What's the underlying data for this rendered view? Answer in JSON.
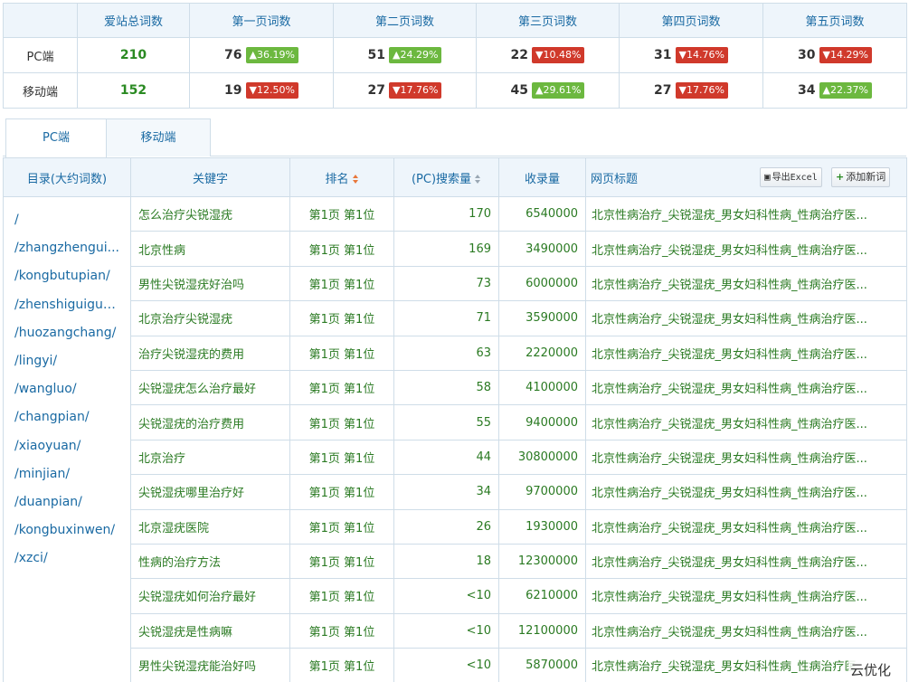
{
  "summary": {
    "headers": [
      "",
      "爱站总词数",
      "第一页词数",
      "第二页词数",
      "第三页词数",
      "第四页词数",
      "第五页词数"
    ],
    "rows": [
      {
        "label": "PC端",
        "total": "210",
        "pages": [
          {
            "num": "76",
            "change": "▲36.19%",
            "dir": "up"
          },
          {
            "num": "51",
            "change": "▲24.29%",
            "dir": "up"
          },
          {
            "num": "22",
            "change": "▼10.48%",
            "dir": "down"
          },
          {
            "num": "31",
            "change": "▼14.76%",
            "dir": "down"
          },
          {
            "num": "30",
            "change": "▼14.29%",
            "dir": "down"
          }
        ]
      },
      {
        "label": "移动端",
        "total": "152",
        "pages": [
          {
            "num": "19",
            "change": "▼12.50%",
            "dir": "down"
          },
          {
            "num": "27",
            "change": "▼17.76%",
            "dir": "down"
          },
          {
            "num": "45",
            "change": "▲29.61%",
            "dir": "up"
          },
          {
            "num": "27",
            "change": "▼17.76%",
            "dir": "down"
          },
          {
            "num": "34",
            "change": "▲22.37%",
            "dir": "up"
          }
        ]
      }
    ]
  },
  "tabs": {
    "pc": "PC端",
    "mobile": "移动端"
  },
  "table": {
    "headers": {
      "dir": "目录(大约词数)",
      "keyword": "关键字",
      "rank": "排名",
      "search": "(PC)搜索量",
      "indexed": "收录量",
      "title": "网页标题"
    },
    "export_label": "导出Excel",
    "add_label": "添加新词",
    "dirs": [
      "/",
      "/zhangzhengui...",
      "/kongbutupian/",
      "/zhenshiguigus...",
      "/huozangchang/",
      "/lingyi/",
      "/wangluo/",
      "/changpian/",
      "/xiaoyuan/",
      "/minjian/",
      "/duanpian/",
      "/kongbuxinwen/",
      "/xzci/"
    ],
    "rows": [
      {
        "kw": "怎么治疗尖锐湿疣",
        "rank": "第1页 第1位",
        "search": "170",
        "indexed": "6540000",
        "title": "北京性病治疗_尖锐湿疣_男女妇科性病_性病治疗医..."
      },
      {
        "kw": "北京性病",
        "rank": "第1页 第1位",
        "search": "169",
        "indexed": "3490000",
        "title": "北京性病治疗_尖锐湿疣_男女妇科性病_性病治疗医..."
      },
      {
        "kw": "男性尖锐湿疣好治吗",
        "rank": "第1页 第1位",
        "search": "73",
        "indexed": "6000000",
        "title": "北京性病治疗_尖锐湿疣_男女妇科性病_性病治疗医..."
      },
      {
        "kw": "北京治疗尖锐湿疣",
        "rank": "第1页 第1位",
        "search": "71",
        "indexed": "3590000",
        "title": "北京性病治疗_尖锐湿疣_男女妇科性病_性病治疗医..."
      },
      {
        "kw": "治疗尖锐湿疣的费用",
        "rank": "第1页 第1位",
        "search": "63",
        "indexed": "2220000",
        "title": "北京性病治疗_尖锐湿疣_男女妇科性病_性病治疗医..."
      },
      {
        "kw": "尖锐湿疣怎么治疗最好",
        "rank": "第1页 第1位",
        "search": "58",
        "indexed": "4100000",
        "title": "北京性病治疗_尖锐湿疣_男女妇科性病_性病治疗医..."
      },
      {
        "kw": "尖锐湿疣的治疗费用",
        "rank": "第1页 第1位",
        "search": "55",
        "indexed": "9400000",
        "title": "北京性病治疗_尖锐湿疣_男女妇科性病_性病治疗医..."
      },
      {
        "kw": "北京治疗",
        "rank": "第1页 第1位",
        "search": "44",
        "indexed": "30800000",
        "title": "北京性病治疗_尖锐湿疣_男女妇科性病_性病治疗医..."
      },
      {
        "kw": "尖锐湿疣哪里治疗好",
        "rank": "第1页 第1位",
        "search": "34",
        "indexed": "9700000",
        "title": "北京性病治疗_尖锐湿疣_男女妇科性病_性病治疗医..."
      },
      {
        "kw": "北京湿疣医院",
        "rank": "第1页 第1位",
        "search": "26",
        "indexed": "1930000",
        "title": "北京性病治疗_尖锐湿疣_男女妇科性病_性病治疗医..."
      },
      {
        "kw": "性病的治疗方法",
        "rank": "第1页 第1位",
        "search": "18",
        "indexed": "12300000",
        "title": "北京性病治疗_尖锐湿疣_男女妇科性病_性病治疗医..."
      },
      {
        "kw": "尖锐湿疣如何治疗最好",
        "rank": "第1页 第1位",
        "search": "<10",
        "indexed": "6210000",
        "title": "北京性病治疗_尖锐湿疣_男女妇科性病_性病治疗医..."
      },
      {
        "kw": "尖锐湿疣是性病嘛",
        "rank": "第1页 第1位",
        "search": "<10",
        "indexed": "12100000",
        "title": "北京性病治疗_尖锐湿疣_男女妇科性病_性病治疗医..."
      },
      {
        "kw": "男性尖锐湿疣能治好吗",
        "rank": "第1页 第1位",
        "search": "<10",
        "indexed": "5870000",
        "title": "北京性病治疗_尖锐湿疣_男女妇科性病_性病治疗医..."
      }
    ]
  },
  "watermark": "云优化"
}
